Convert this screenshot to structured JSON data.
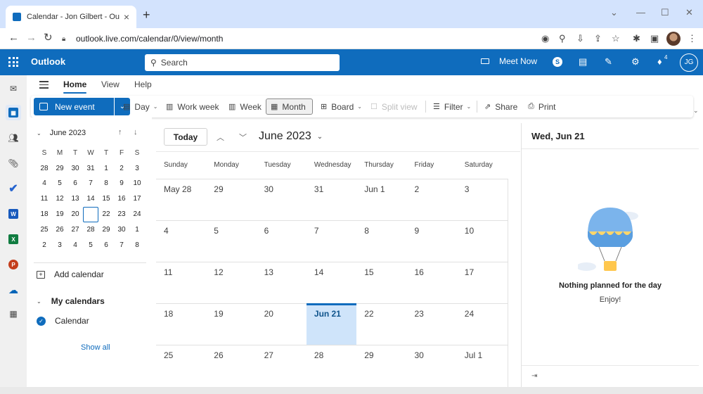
{
  "browser": {
    "tab_title": "Calendar - Jon Gilbert - Outlook",
    "tab_close": "×",
    "new_tab": "+",
    "url": "outlook.live.com/calendar/0/view/month",
    "window_min": "—",
    "window_max": "☐",
    "window_close": "✕",
    "window_chevron": "⌄"
  },
  "header": {
    "brand": "Outlook",
    "search_placeholder": "Search",
    "meet_now": "Meet Now",
    "skype_letter": "S",
    "notification_count": "4",
    "avatar_initials": "JG"
  },
  "ribbon": {
    "tabs": [
      {
        "label": "Home",
        "active": true
      },
      {
        "label": "View",
        "active": false
      },
      {
        "label": "Help",
        "active": false
      }
    ],
    "new_event": "New event",
    "day": "Day",
    "work_week": "Work week",
    "week": "Week",
    "month": "Month",
    "board": "Board",
    "split_view": "Split view",
    "filter": "Filter",
    "share": "Share",
    "print": "Print"
  },
  "mini_calendar": {
    "title": "June 2023",
    "weekdays": [
      "S",
      "M",
      "T",
      "W",
      "T",
      "F",
      "S"
    ],
    "weeks": [
      [
        "28",
        "29",
        "30",
        "31",
        "1",
        "2",
        "3"
      ],
      [
        "4",
        "5",
        "6",
        "7",
        "8",
        "9",
        "10"
      ],
      [
        "11",
        "12",
        "13",
        "14",
        "15",
        "16",
        "17"
      ],
      [
        "18",
        "19",
        "20",
        "21",
        "22",
        "23",
        "24"
      ],
      [
        "25",
        "26",
        "27",
        "28",
        "29",
        "30",
        "1"
      ],
      [
        "2",
        "3",
        "4",
        "5",
        "6",
        "7",
        "8"
      ]
    ],
    "today_label": "21"
  },
  "left_pane": {
    "add_calendar": "Add calendar",
    "my_calendars": "My calendars",
    "calendar_item": "Calendar",
    "show_all": "Show all"
  },
  "month_view": {
    "today_button": "Today",
    "title": "June 2023",
    "weekdays": [
      "Sunday",
      "Monday",
      "Tuesday",
      "Wednesday",
      "Thursday",
      "Friday",
      "Saturday"
    ],
    "weeks": [
      [
        "May 28",
        "29",
        "30",
        "31",
        "Jun 1",
        "2",
        "3"
      ],
      [
        "4",
        "5",
        "6",
        "7",
        "8",
        "9",
        "10"
      ],
      [
        "11",
        "12",
        "13",
        "14",
        "15",
        "16",
        "17"
      ],
      [
        "18",
        "19",
        "20",
        "Jun 21",
        "22",
        "23",
        "24"
      ],
      [
        "25",
        "26",
        "27",
        "28",
        "29",
        "30",
        "Jul 1"
      ]
    ],
    "today_cell": "Jun 21"
  },
  "day_pane": {
    "title": "Wed, Jun 21",
    "empty_title": "Nothing planned for the day",
    "empty_subtitle": "Enjoy!"
  },
  "colors": {
    "brand_blue": "#0f6cbd",
    "today_highlight": "#cfe4fa",
    "tab_strip": "#d3e3fd"
  }
}
